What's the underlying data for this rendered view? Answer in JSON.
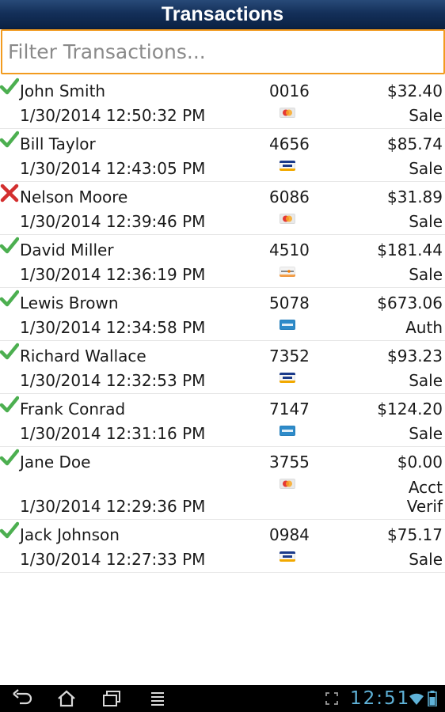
{
  "app": {
    "title": "Transactions"
  },
  "filter": {
    "placeholder": "Filter Transactions..."
  },
  "transactions": [
    {
      "name": "John Smith",
      "card_last4": "0016",
      "amount": "$32.40",
      "datetime": "1/30/2014 12:50:32 PM",
      "type": "Sale",
      "status": "check-icon",
      "card": "mastercard-icon"
    },
    {
      "name": "Bill Taylor",
      "card_last4": "4656",
      "amount": "$85.74",
      "datetime": "1/30/2014 12:43:05 PM",
      "type": "Sale",
      "status": "check-icon",
      "card": "visa-icon"
    },
    {
      "name": "Nelson Moore",
      "card_last4": "6086",
      "amount": "$31.89",
      "datetime": "1/30/2014 12:39:46 PM",
      "type": "Sale",
      "status": "x-icon",
      "card": "mastercard-icon"
    },
    {
      "name": "David Miller",
      "card_last4": "4510",
      "amount": "$181.44",
      "datetime": "1/30/2014 12:36:19 PM",
      "type": "Sale",
      "status": "check-icon",
      "card": "discover-icon"
    },
    {
      "name": "Lewis Brown",
      "card_last4": "5078",
      "amount": "$673.06",
      "datetime": "1/30/2014 12:34:58 PM",
      "type": "Auth",
      "status": "check-icon",
      "card": "amex-icon"
    },
    {
      "name": "Richard Wallace",
      "card_last4": "7352",
      "amount": "$93.23",
      "datetime": "1/30/2014 12:32:53 PM",
      "type": "Sale",
      "status": "check-icon",
      "card": "visa-icon"
    },
    {
      "name": "Frank Conrad",
      "card_last4": "7147",
      "amount": "$124.20",
      "datetime": "1/30/2014 12:31:16 PM",
      "type": "Sale",
      "status": "check-icon",
      "card": "amex-icon"
    },
    {
      "name": "Jane Doe",
      "card_last4": "3755",
      "amount": "$0.00",
      "datetime": "1/30/2014 12:29:36 PM",
      "type": "Acct Verif",
      "status": "check-icon",
      "card": "mastercard-icon"
    },
    {
      "name": "Jack Johnson",
      "card_last4": "0984",
      "amount": "$75.17",
      "datetime": "1/30/2014 12:27:33 PM",
      "type": "Sale",
      "status": "check-icon",
      "card": "visa-icon"
    }
  ],
  "system_bar": {
    "clock": "12:51",
    "icons": [
      "back-icon",
      "home-icon",
      "recent-apps-icon",
      "menu-icon",
      "fullscreen-icon",
      "wifi-icon",
      "battery-icon"
    ]
  },
  "colors": {
    "title_bar": "#14305a",
    "filter_border": "#f29b1f",
    "check": "#4caf50",
    "x_mark": "#d32f2f",
    "clock": "#5fb2d8"
  }
}
